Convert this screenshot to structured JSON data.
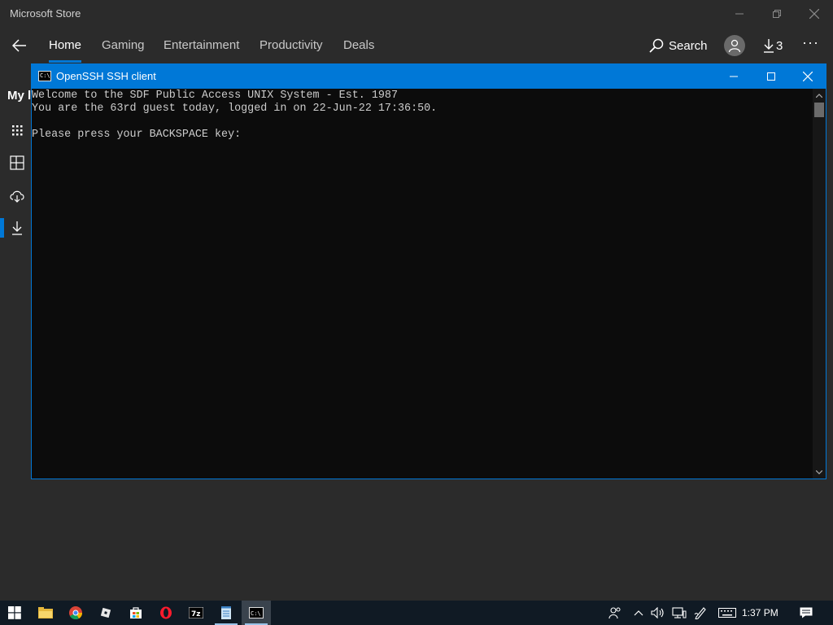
{
  "store": {
    "window_title": "Microsoft Store",
    "nav_tabs": [
      {
        "label": "Home",
        "active": true
      },
      {
        "label": "Gaming",
        "active": false
      },
      {
        "label": "Entertainment",
        "active": false
      },
      {
        "label": "Productivity",
        "active": false
      },
      {
        "label": "Deals",
        "active": false
      }
    ],
    "search_label": "Search",
    "downloads_count": "3",
    "more_label": "···",
    "sidebar_heading": "My l",
    "sidebar_icons": [
      "apps-grid-icon",
      "library-icon",
      "cloud-download-icon",
      "downloads-icon"
    ]
  },
  "ssh": {
    "window_title": "OpenSSH SSH client",
    "icon_text": "C:\\",
    "terminal_lines": [
      "Welcome to the SDF Public Access UNIX System - Est. 1987",
      "You are the 63rd guest today, logged in on 22-Jun-22 17:36:50.",
      "",
      "Please press your BACKSPACE key:"
    ]
  },
  "taskbar": {
    "apps": [
      {
        "name": "file-explorer-icon"
      },
      {
        "name": "chrome-icon"
      },
      {
        "name": "roblox-icon"
      },
      {
        "name": "store-icon"
      },
      {
        "name": "opera-icon"
      },
      {
        "name": "7zip-icon",
        "label": "7z"
      },
      {
        "name": "notepad-icon"
      },
      {
        "name": "terminal-icon",
        "label": "C:\\",
        "active": true
      }
    ],
    "clock": "1:37 PM"
  },
  "colors": {
    "accent": "#0078d7",
    "store_background": "#2b2b2b",
    "terminal_background": "#0c0c0c",
    "terminal_text": "#cccccc",
    "taskbar": "#101a24"
  }
}
